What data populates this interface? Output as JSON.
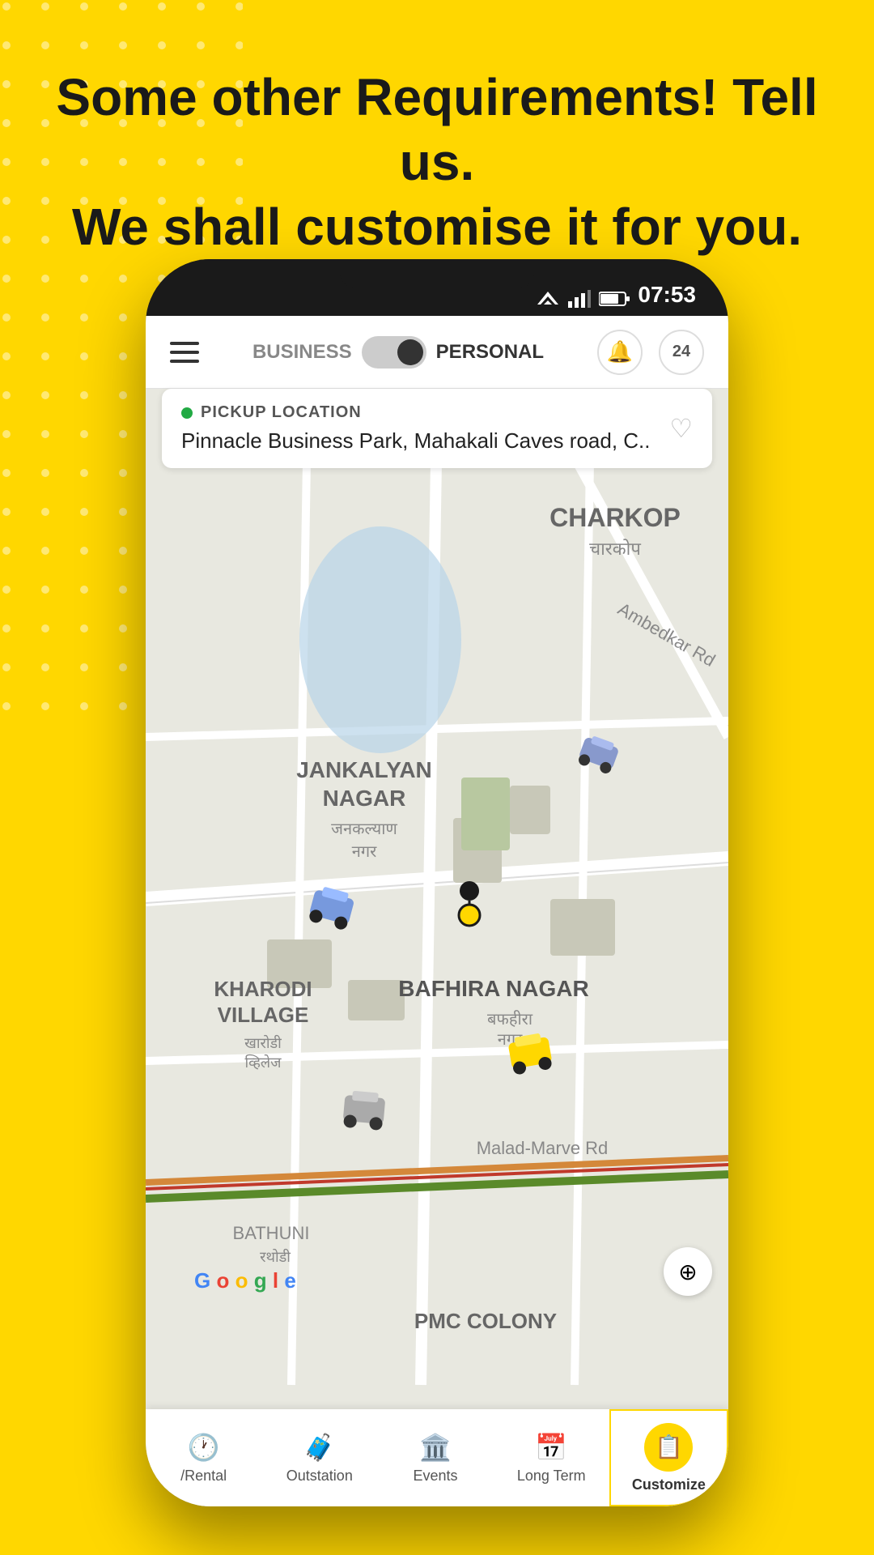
{
  "hero": {
    "line1": "Some other Requirements! Tell us.",
    "line2": "We shall customise it for you."
  },
  "status_bar": {
    "time": "07:53"
  },
  "top_bar": {
    "business_label": "BUSINESS",
    "personal_label": "PERSONAL"
  },
  "pickup": {
    "label": "PICKUP LOCATION",
    "address": "Pinnacle Business Park, Mahakali Caves road, C.."
  },
  "map": {
    "labels": [
      {
        "name": "CHARKOP",
        "sub": "चारकोप"
      },
      {
        "name": "JANKALYAN\nNAGAR",
        "sub": "जनकल्याण\nनगर"
      },
      {
        "name": "KHARODI\nVILLAGE",
        "sub": "खारोडी\nव्हिलेज"
      },
      {
        "name": "BAFHIRA NAGAR",
        "sub": "बफहीरा\nनगर"
      }
    ]
  },
  "bottom_nav": {
    "items": [
      {
        "label": "/Rental",
        "icon": "🕐"
      },
      {
        "label": "Outstation",
        "icon": "🧳"
      },
      {
        "label": "Events",
        "icon": "🏛️"
      },
      {
        "label": "Long Term",
        "icon": "📅"
      },
      {
        "label": "Customize",
        "icon": "📋",
        "active": true
      }
    ]
  }
}
